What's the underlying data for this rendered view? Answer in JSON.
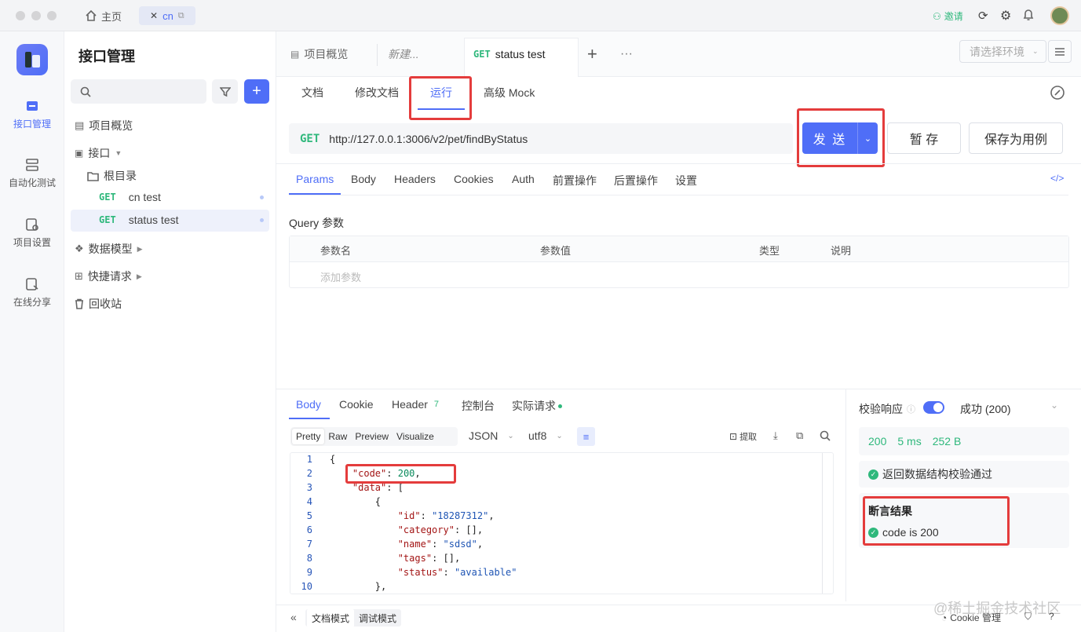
{
  "titlebar": {
    "home": "主页",
    "tab": "cn",
    "invite": "邀请"
  },
  "nav": {
    "items": [
      {
        "label": "接口管理"
      },
      {
        "label": "自动化测试"
      },
      {
        "label": "项目设置"
      },
      {
        "label": "在线分享"
      }
    ]
  },
  "sidebar": {
    "title": "接口管理",
    "overview": "项目概览",
    "api": "接口",
    "root": "根目录",
    "api_items": [
      {
        "method": "GET",
        "name": "cn test"
      },
      {
        "method": "GET",
        "name": "status test"
      }
    ],
    "models": "数据模型",
    "quick": "快捷请求",
    "trash": "回收站"
  },
  "doc_tabs": {
    "overview": "项目概览",
    "new": "新建...",
    "active_method": "GET",
    "active_name": "status test",
    "add": "+",
    "more": "···",
    "env_placeholder": "请选择环境"
  },
  "subtabs": [
    "文档",
    "修改文档",
    "运行",
    "高级 Mock"
  ],
  "request": {
    "method": "GET",
    "url": "http://127.0.0.1:3006/v2/pet/findByStatus",
    "send": "发 送",
    "save_temp": "暂 存",
    "save_case": "保存为用例"
  },
  "param_tabs": [
    "Params",
    "Body",
    "Headers",
    "Cookies",
    "Auth",
    "前置操作",
    "后置操作",
    "设置"
  ],
  "query": {
    "title": "Query 参数",
    "columns": [
      "参数名",
      "参数值",
      "类型",
      "说明"
    ],
    "add_placeholder": "添加参数"
  },
  "response": {
    "tabs": [
      "Body",
      "Cookie",
      "Header",
      "控制台",
      "实际请求"
    ],
    "header_count": "7",
    "formats": [
      "Pretty",
      "Raw",
      "Preview",
      "Visualize"
    ],
    "lang": "JSON",
    "encoding": "utf8",
    "extract": "提取",
    "lines": [
      "1",
      "2",
      "3",
      "4",
      "5",
      "6",
      "7",
      "8",
      "9",
      "10"
    ]
  },
  "validation": {
    "label": "校验响应",
    "result": "成功 (200)",
    "status": "200",
    "time": "5 ms",
    "size": "252 B",
    "schema_pass": "返回数据结构校验通过",
    "assert_title": "断言结果",
    "assert_item": "code is 200"
  },
  "footer": {
    "doc_mode": "文档模式",
    "debug_mode": "调试模式",
    "cookie": "Cookie 管理",
    "watermark": "@稀土掘金技术社区"
  },
  "colors": {
    "accent": "#4f6ef7",
    "get": "#2fb87c",
    "highlight": "#e43c3c"
  }
}
